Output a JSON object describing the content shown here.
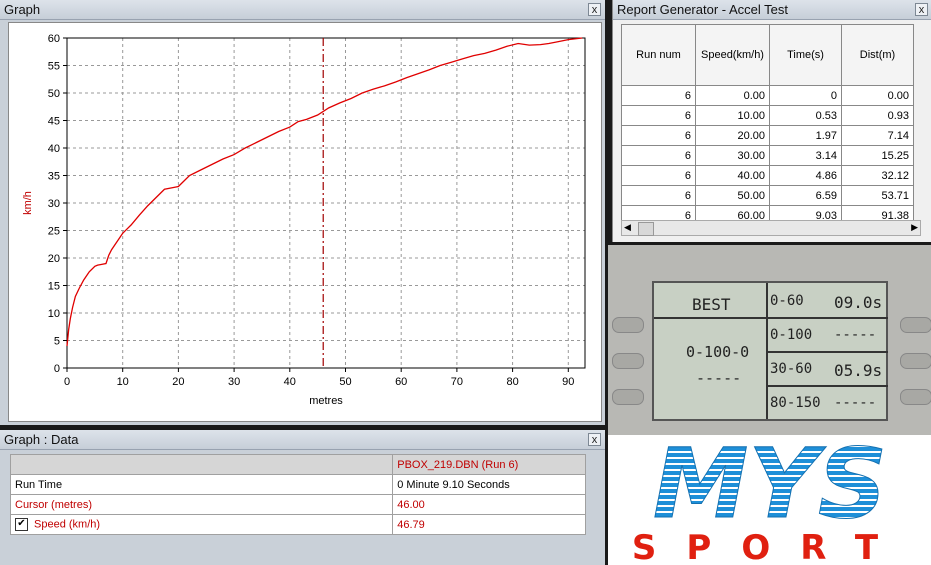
{
  "graph_window": {
    "title": "Graph",
    "close": "x"
  },
  "chart_data": {
    "type": "line",
    "xlabel": "metres",
    "ylabel": "km/h",
    "xlim": [
      0,
      93
    ],
    "ylim": [
      0,
      60
    ],
    "x_ticks": [
      0,
      10,
      20,
      30,
      40,
      50,
      60,
      70,
      80,
      90
    ],
    "y_ticks": [
      0,
      5,
      10,
      15,
      20,
      25,
      30,
      35,
      40,
      45,
      50,
      55,
      60
    ],
    "cursor_x": 46.0,
    "grid": true,
    "series": [
      {
        "color": "#e00000",
        "x": [
          0,
          0.3,
          0.6,
          1.0,
          1.5,
          2.2,
          3.0,
          4.0,
          5.0,
          5.5,
          6.0,
          7.0,
          7.5,
          8.0,
          9.0,
          10.0,
          11.5,
          13.0,
          14.5,
          16.0,
          17.5,
          19.0,
          20.0,
          21.0,
          22.0,
          24.0,
          26.0,
          28.0,
          30.0,
          32.0,
          34.0,
          36.0,
          38.0,
          40.0,
          41.5,
          43.0,
          45.0,
          47.0,
          49.0,
          51.0,
          53.0,
          55.0,
          57.0,
          59.0,
          61.0,
          63.0,
          65.0,
          67.0,
          69.0,
          71.0,
          73.0,
          75.0,
          77.0,
          79.0,
          81.0,
          83.0,
          85.0,
          86.5,
          88.0,
          90.0,
          92.5
        ],
        "y": [
          4,
          7,
          9,
          11,
          13,
          14.5,
          16,
          17.5,
          18.5,
          18.7,
          18.8,
          19.0,
          20.5,
          21.5,
          23.0,
          24.5,
          26.0,
          27.8,
          29.5,
          31.0,
          32.5,
          32.8,
          33.0,
          34.0,
          35.0,
          36.0,
          37.0,
          38.0,
          38.8,
          40.0,
          41.0,
          42.0,
          43.0,
          43.8,
          44.8,
          45.2,
          46.0,
          47.3,
          48.2,
          49.0,
          50.0,
          50.7,
          51.3,
          52.0,
          52.8,
          53.5,
          54.2,
          55.0,
          55.6,
          56.2,
          56.8,
          57.2,
          57.8,
          58.5,
          59.0,
          58.7,
          58.8,
          59.0,
          59.3,
          59.7,
          60.0
        ]
      }
    ]
  },
  "data_window": {
    "title": "Graph : Data",
    "close": "x",
    "header_file": "PBOX_219.DBN (Run 6)",
    "rows": [
      {
        "label": "Run Time",
        "value": "0 Minute 9.10 Seconds"
      },
      {
        "label": "Cursor (metres)",
        "value": "46.00"
      },
      {
        "label": "Speed (km/h)",
        "value": "46.79",
        "checked": true
      }
    ]
  },
  "report_window": {
    "title": "Report Generator - Accel Test",
    "close": "x",
    "columns": [
      "Run num",
      "Speed(km/h)",
      "Time(s)",
      "Dist(m)"
    ],
    "rows": [
      [
        "6",
        "0.00",
        "0",
        "0.00"
      ],
      [
        "6",
        "10.00",
        "0.53",
        "0.93"
      ],
      [
        "6",
        "20.00",
        "1.97",
        "7.14"
      ],
      [
        "6",
        "30.00",
        "3.14",
        "15.25"
      ],
      [
        "6",
        "40.00",
        "4.86",
        "32.12"
      ],
      [
        "6",
        "50.00",
        "6.59",
        "53.71"
      ],
      [
        "6",
        "60.00",
        "9.03",
        "91.38"
      ]
    ]
  },
  "lcd": {
    "best": "BEST",
    "left_main": "0-100-0",
    "left_sub": "-----",
    "cells": [
      {
        "label": "0-60",
        "value": "09.0s"
      },
      {
        "label": "0-100",
        "value": "-----"
      },
      {
        "label": "30-60",
        "value": "05.9s"
      },
      {
        "label": "80-150",
        "value": "-----"
      }
    ]
  },
  "logo": {
    "top": "MYS",
    "bottom": "SPORT",
    "top_color": "#1e8fd8",
    "bottom_color": "#e02010"
  }
}
